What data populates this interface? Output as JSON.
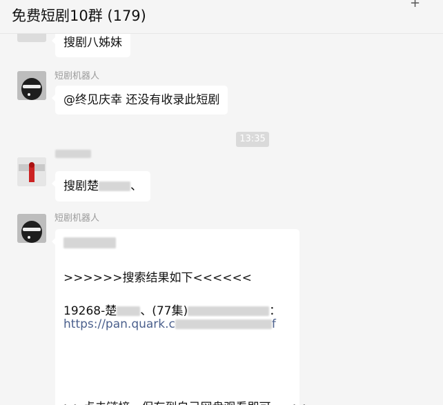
{
  "header": {
    "title": "免费短剧10群 (179)",
    "icon": "plus-icon"
  },
  "messages": {
    "m0": {
      "text": "搜剧八姊妹"
    },
    "m1": {
      "sender": "短剧机器人",
      "text": "@终见庆幸 还没有收录此短剧"
    },
    "time": "13:35",
    "m2": {
      "sender": "",
      "text_prefix": "搜剧楚",
      "text_suffix": "、"
    },
    "m3": {
      "sender": "短剧机器人",
      "line1": ">>>>>>搜索结果如下<<<<<<",
      "line2_prefix": "19268-楚",
      "line2_mid": "、(77集)",
      "line2_suffix": "：",
      "link_prefix": "https://pan.quark.c",
      "link_suffix": "f",
      "footer": ">>点击链接，保存到自己网盘观看即可。 <<"
    }
  }
}
